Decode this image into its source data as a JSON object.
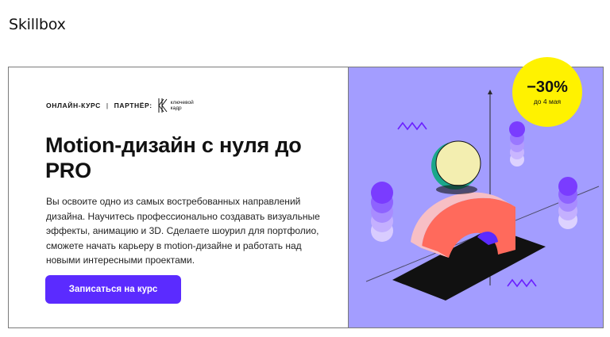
{
  "header": {
    "logo": "Skillbox"
  },
  "banner": {
    "meta": {
      "type_label": "ОНЛАЙН-КУРС",
      "separator": "|",
      "partner_label": "ПАРТНЁР:",
      "partner_name": "ключевой кадр"
    },
    "title": "Motion-дизайн с нуля до PRO",
    "description": "Вы освоите одно из самых востребованных направлений дизайна. Научитесь профессионально создавать визуальные эффекты, анимацию и 3D. Сделаете шоурил для портфолио, сможете начать карьеру в motion-дизайне и работать над новыми интересными проектами.",
    "cta_label": "Записаться на курс",
    "discount": {
      "value": "−30%",
      "until": "до 4 мая"
    },
    "colors": {
      "accent": "#5b2bff",
      "illustration_bg": "#a39dff",
      "badge": "#fff200"
    }
  }
}
